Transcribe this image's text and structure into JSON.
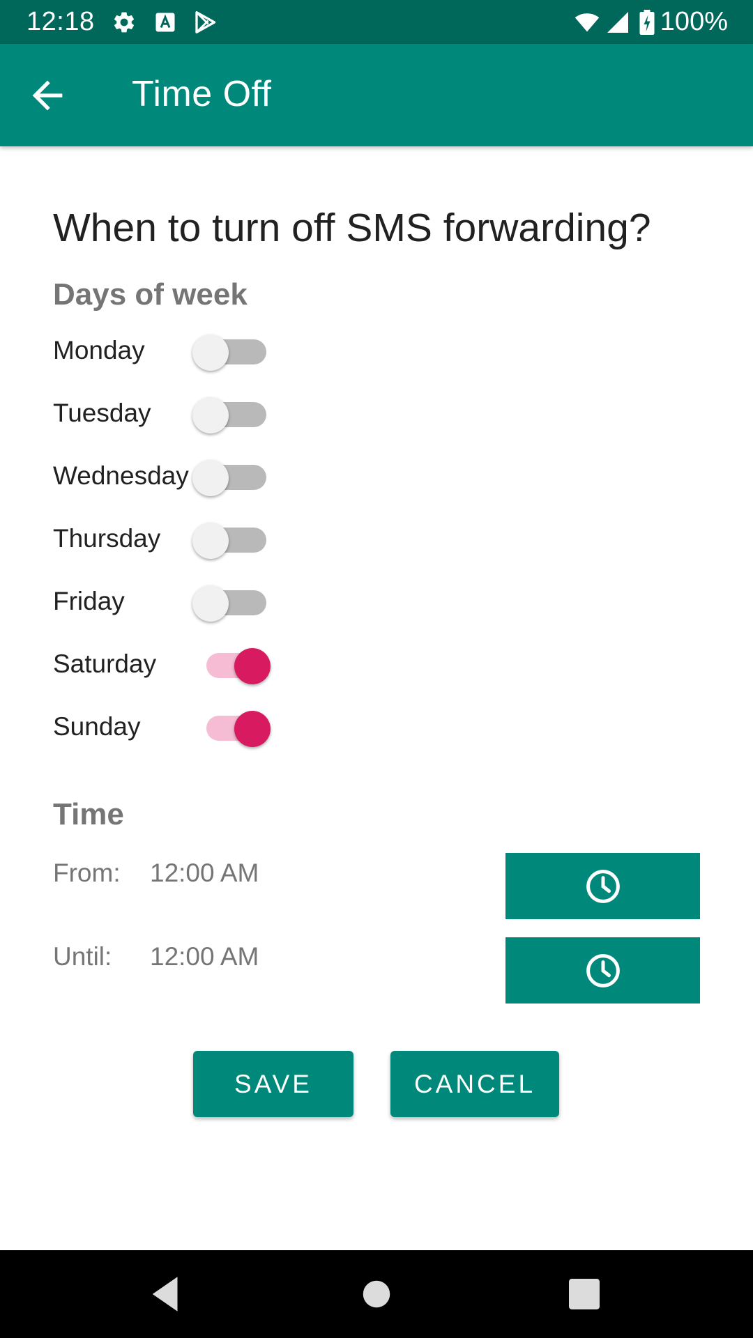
{
  "status_bar": {
    "time": "12:18",
    "battery_percent": "100%",
    "icons": [
      "gear-icon",
      "font-a-icon",
      "play-store-icon",
      "wifi-icon",
      "cell-signal-icon",
      "battery-charging-icon"
    ]
  },
  "app_bar": {
    "title": "Time Off",
    "back_icon": "arrow-back-icon",
    "background_color": "#00897b"
  },
  "question": "When to turn off SMS forwarding?",
  "days_section": {
    "header": "Days of week",
    "days": [
      {
        "label": "Monday",
        "enabled": false
      },
      {
        "label": "Tuesday",
        "enabled": false
      },
      {
        "label": "Wednesday",
        "enabled": false
      },
      {
        "label": "Thursday",
        "enabled": false
      },
      {
        "label": "Friday",
        "enabled": false
      },
      {
        "label": "Saturday",
        "enabled": true
      },
      {
        "label": "Sunday",
        "enabled": true
      }
    ],
    "switch_on_color": "#d81b60"
  },
  "time_section": {
    "header": "Time",
    "from_label": "From:",
    "from_value": "12:00 AM",
    "until_label": "Until:",
    "until_value": "12:00 AM",
    "picker_icon": "clock-icon"
  },
  "actions": {
    "save_label": "SAVE",
    "cancel_label": "CANCEL"
  },
  "nav_bar": {
    "icons": [
      "back-triangle-icon",
      "home-circle-icon",
      "recents-square-icon"
    ]
  }
}
